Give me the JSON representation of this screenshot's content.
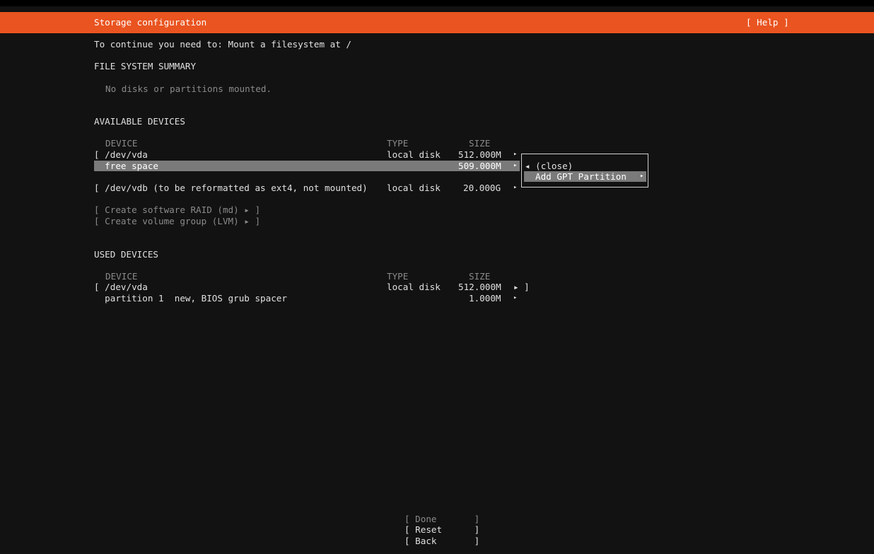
{
  "header": {
    "title": "Storage configuration",
    "help": "[ Help ]"
  },
  "notice": "To continue you need to: Mount a filesystem at /",
  "fs_summary": {
    "heading": "FILE SYSTEM SUMMARY",
    "empty": "No disks or partitions mounted."
  },
  "available": {
    "heading": "AVAILABLE DEVICES",
    "columns": {
      "device": "DEVICE",
      "type": "TYPE",
      "size": "SIZE"
    },
    "rows": [
      {
        "device": "[ /dev/vda",
        "type": "local disk",
        "size": "512.000M",
        "arrow": "▸"
      },
      {
        "device": "  free space",
        "type": "",
        "size": "509.000M",
        "arrow": "▸"
      },
      {
        "device": "[ /dev/vdb (to be reformatted as ext4, not mounted)",
        "type": "local disk",
        "size": "20.000G",
        "arrow": "▸"
      }
    ],
    "actions": [
      "[ Create software RAID (md) ▸ ]",
      "[ Create volume group (LVM) ▸ ]"
    ]
  },
  "popup": {
    "close": "◂ (close)",
    "item": "Add GPT Partition",
    "item_arrow": "▸"
  },
  "used": {
    "heading": "USED DEVICES",
    "columns": {
      "device": "DEVICE",
      "type": "TYPE",
      "size": "SIZE"
    },
    "rows": [
      {
        "device": "[ /dev/vda",
        "type": "local disk",
        "size": "512.000M",
        "arrow": "▸ ]"
      },
      {
        "device": "  partition 1  new, BIOS grub spacer",
        "type": "",
        "size": "1.000M",
        "arrow": "▸"
      }
    ]
  },
  "buttons": {
    "done": "[ Done       ]",
    "reset": "[ Reset      ]",
    "back": "[ Back       ]"
  }
}
